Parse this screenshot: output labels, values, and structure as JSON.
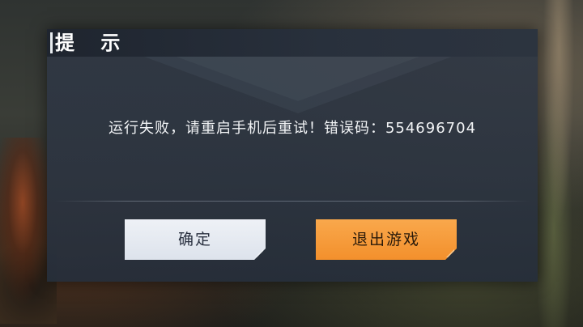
{
  "dialog": {
    "title": "提 示",
    "message": "运行失败，请重启手机后重试！错误码：554696704",
    "confirm_label": "确定",
    "exit_label": "退出游戏"
  },
  "colors": {
    "dialog_bg": "#303844",
    "confirm_button": "#e8ecf2",
    "exit_button": "#f59a38",
    "text": "#ffffff"
  }
}
